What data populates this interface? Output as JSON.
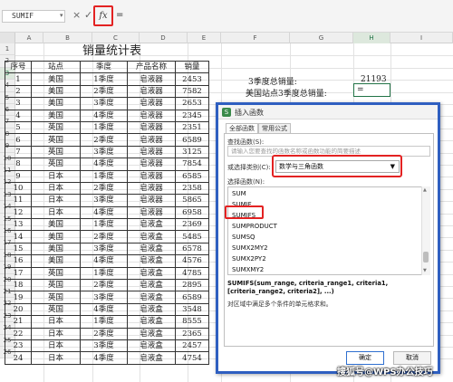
{
  "formula_bar": {
    "name_box": "SUMIF",
    "cancel_icon": "×",
    "confirm_icon": "✓",
    "fx_label": "fx",
    "formula": "="
  },
  "columns": [
    "A",
    "B",
    "C",
    "D",
    "E",
    "F",
    "G",
    "H",
    "I"
  ],
  "rows": [
    "1",
    "2",
    "3",
    "4",
    "5",
    "6",
    "7",
    "8",
    "9",
    "10",
    "11",
    "12",
    "13",
    "14",
    "15",
    "16",
    "17",
    "18",
    "19",
    "20",
    "21",
    "22",
    "23",
    "24",
    "25",
    "26"
  ],
  "table": {
    "title": "销量统计表",
    "headers": [
      "序号",
      "站点",
      "季度",
      "产品名称",
      "销量"
    ],
    "rows": [
      [
        "1",
        "美国",
        "1季度",
        "皂液器",
        "2453"
      ],
      [
        "2",
        "美国",
        "2季度",
        "皂液器",
        "7582"
      ],
      [
        "3",
        "美国",
        "3季度",
        "皂液器",
        "2653"
      ],
      [
        "4",
        "美国",
        "4季度",
        "皂液器",
        "2345"
      ],
      [
        "5",
        "英国",
        "1季度",
        "皂液器",
        "2351"
      ],
      [
        "6",
        "英国",
        "2季度",
        "皂液器",
        "6589"
      ],
      [
        "7",
        "英国",
        "3季度",
        "皂液器",
        "3125"
      ],
      [
        "8",
        "英国",
        "4季度",
        "皂液器",
        "7854"
      ],
      [
        "9",
        "日本",
        "1季度",
        "皂液器",
        "6585"
      ],
      [
        "10",
        "日本",
        "2季度",
        "皂液器",
        "2358"
      ],
      [
        "11",
        "日本",
        "3季度",
        "皂液器",
        "5865"
      ],
      [
        "12",
        "日本",
        "4季度",
        "皂液器",
        "6958"
      ],
      [
        "13",
        "美国",
        "1季度",
        "皂液盒",
        "2369"
      ],
      [
        "14",
        "美国",
        "2季度",
        "皂液盒",
        "5485"
      ],
      [
        "15",
        "美国",
        "3季度",
        "皂液盒",
        "6578"
      ],
      [
        "16",
        "美国",
        "4季度",
        "皂液盒",
        "4576"
      ],
      [
        "17",
        "英国",
        "1季度",
        "皂液盒",
        "4785"
      ],
      [
        "18",
        "英国",
        "2季度",
        "皂液盒",
        "2895"
      ],
      [
        "19",
        "英国",
        "3季度",
        "皂液盒",
        "6589"
      ],
      [
        "20",
        "英国",
        "4季度",
        "皂液盒",
        "3548"
      ],
      [
        "21",
        "日本",
        "1季度",
        "皂液盒",
        "8555"
      ],
      [
        "22",
        "日本",
        "2季度",
        "皂液盒",
        "2365"
      ],
      [
        "23",
        "日本",
        "3季度",
        "皂液盒",
        "2457"
      ],
      [
        "24",
        "日本",
        "4季度",
        "皂液盒",
        "4754"
      ]
    ]
  },
  "side": {
    "q3_label": "3季度总销量:",
    "q3_value": "21193",
    "us_q3_label": "美国站点3季度总销量:",
    "us_q3_value": "="
  },
  "dialog": {
    "title": "插入函数",
    "tabs": [
      "全部函数",
      "常用公式"
    ],
    "search_label": "查找函数(S):",
    "search_placeholder": "请输入您要查找的函数名称或函数功能的简要描述",
    "category_label": "或选择类别(C):",
    "category_value": "数学与三角函数",
    "func_label": "选择函数(N):",
    "functions": [
      "SUM",
      "SUMIF",
      "SUMIFS",
      "SUMPRODUCT",
      "SUMSQ",
      "SUMX2MY2",
      "SUMX2PY2",
      "SUMXMY2"
    ],
    "syntax": "SUMIFS(sum_range, criteria_range1, criteria1, [criteria_range2, criteria2], ...)",
    "description": "对区域中满足多个条件的单元格求和。",
    "ok": "确定",
    "cancel": "取消"
  },
  "watermark": "搜狐号@WPS办公技巧"
}
